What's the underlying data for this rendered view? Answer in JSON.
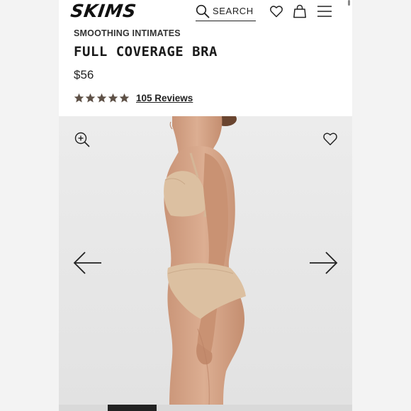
{
  "header": {
    "logo": "SKIMS",
    "search_label": "SEARCH"
  },
  "product": {
    "category": "SMOOTHING INTIMATES",
    "title": "FULL COVERAGE BRA",
    "price": "$56",
    "rating": 5,
    "reviews_label": "105 Reviews"
  },
  "gallery": {
    "current_image": 2,
    "image_count": 6,
    "icons": [
      "zoom-in-icon",
      "heart-icon",
      "arrow-left-icon",
      "arrow-right-icon"
    ]
  },
  "colors": {
    "star": "#5e5147",
    "text": "#1a1a1a",
    "image_bg": "#eaeaea",
    "skin": "#d7a88a",
    "garment": "#dcc0a1"
  }
}
